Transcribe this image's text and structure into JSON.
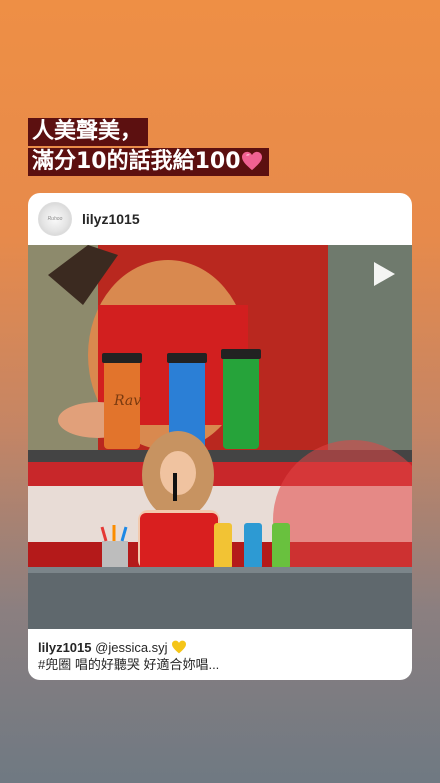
{
  "caption": {
    "line1": "人美聲美，",
    "line2": "滿分10的話我給100"
  },
  "post": {
    "username": "lilyz1015",
    "avatar_text": "Ruhoo",
    "tumbler_text": "Rav",
    "footer": {
      "username": "lilyz1015",
      "mention": "@jessica.syj",
      "text": "#兜圈 唱的好聽哭 好適合妳唱..."
    }
  },
  "icons": [
    "pink-heart-icon",
    "play-icon",
    "yellow-heart-icon"
  ],
  "colors": {
    "caption_bg": "#5c1010",
    "card_bg": "#ffffff",
    "pink_heart": "#f06292",
    "yellow_heart": "#f5c518"
  }
}
